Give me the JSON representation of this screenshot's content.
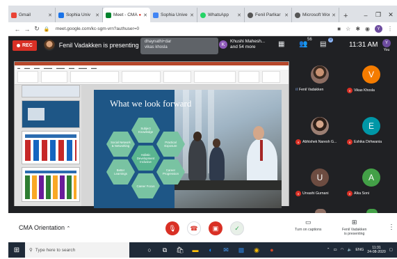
{
  "browser": {
    "tabs": [
      {
        "label": "Gmail",
        "color": "#ea4335",
        "active": false
      },
      {
        "label": "Sophia Univ",
        "color": "#1a73e8",
        "active": false
      },
      {
        "label": "Meet - CMA",
        "color": "#00832d",
        "active": true
      },
      {
        "label": "Sophia Unive",
        "color": "#4285f4",
        "active": false
      },
      {
        "label": "WhatsApp",
        "color": "#25d366",
        "active": false
      },
      {
        "label": "Fenil Parlkar",
        "color": "#555555",
        "active": false
      },
      {
        "label": "Microsoft Wor",
        "color": "#555555",
        "active": false
      }
    ],
    "url": "meet.google.com/kc-sgm-vrn?authuser=0"
  },
  "meet_top": {
    "rec_label": "REC",
    "presenting_text": "Fenil Vadakken is presenting",
    "chat_popup_line1": "dhaynathi+dar",
    "chat_popup_line2": "vikas khosla",
    "joiner_initial": "K",
    "joiner_line1": "Khushi Mahesh...",
    "joiner_line2": "and 54 more",
    "people_count": "56",
    "chat_count": "9",
    "time": "11:31 AM",
    "you_initial": "Y",
    "you_label": "You"
  },
  "slide": {
    "title": "What we look forward",
    "hexes": {
      "top": "Subject Knowledge",
      "upper_left": "Social Network & Networking",
      "upper_right": "Practical Exposure",
      "center": "Holistic Development Inclusive",
      "lower_left": "Better Learnings",
      "lower_right": "Career Progression",
      "bottom": "Career Focus"
    }
  },
  "participants": [
    {
      "name": "Fenil Vadakken",
      "initial": "",
      "color": "#8d6e63",
      "speaking": true
    },
    {
      "name": "Vikas Khosla",
      "initial": "V",
      "color": "#f57c00",
      "speaking": false
    },
    {
      "name": "Abhishek Naresh G...",
      "initial": "",
      "color": "#6d4c41",
      "speaking": false
    },
    {
      "name": "Eshika Dirhwania",
      "initial": "E",
      "color": "#0097a7",
      "speaking": false
    },
    {
      "name": "Urvashi Gurnani",
      "initial": "U",
      "color": "#6d4c41",
      "speaking": false
    },
    {
      "name": "Alka Soni",
      "initial": "A",
      "color": "#43a047",
      "speaking": false
    }
  ],
  "bottom": {
    "meeting_name": "CMA Orientation",
    "captions_label": "Turn on captions",
    "presenting_label_1": "Fenil Vadakken",
    "presenting_label_2": "is presenting"
  },
  "taskbar": {
    "search_placeholder": "Type here to search",
    "time": "11:31",
    "date": "24-08-2020",
    "lang": "ENG"
  }
}
